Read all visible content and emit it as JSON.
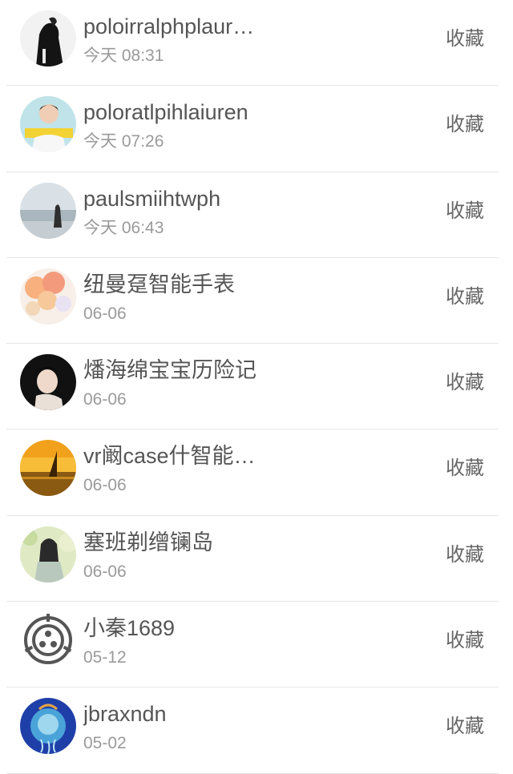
{
  "favorite_label": "收藏",
  "items": [
    {
      "name": "poloirralphplaur…",
      "time": "今天 08:31",
      "avatar": "person-in-black-coat-avatar"
    },
    {
      "name": "poloratlpihlaiuren",
      "time": "今天 07:26",
      "avatar": "boy-with-banner-avatar"
    },
    {
      "name": "paulsmiihtwph",
      "time": "今天 06:43",
      "avatar": "girl-at-seaside-avatar"
    },
    {
      "name": "纽曼趸智能手表",
      "time": "06-06",
      "avatar": "balloons-avatar"
    },
    {
      "name": "燔海绵宝宝历险记",
      "time": "06-06",
      "avatar": "woman-portrait-avatar"
    },
    {
      "name": "vr阚case什智能…",
      "time": "06-06",
      "avatar": "sunset-sailboat-avatar"
    },
    {
      "name": "塞班剃缯镧岛",
      "time": "06-06",
      "avatar": "girl-in-garden-avatar"
    },
    {
      "name": "小秦1689",
      "time": "05-12",
      "avatar": "scp-logo-avatar"
    },
    {
      "name": "jbraxndn",
      "time": "05-02",
      "avatar": "blue-jellyfish-avatar"
    }
  ]
}
